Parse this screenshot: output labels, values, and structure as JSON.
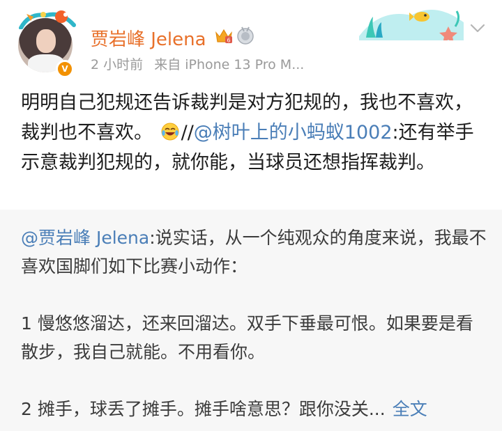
{
  "post": {
    "username": "贾岩峰 Jelena",
    "time": "2 小时前",
    "source": "来自 iPhone 13 Pro M...",
    "verified_badge": "V",
    "text_part1": "明明自己犯规还告诉裁判是对方犯规的，我也不喜欢，裁判也不喜欢。",
    "emoji": "laughing-crying-emoji",
    "text_sep": "//",
    "mention": "@树叶上的小蚂蚁1002",
    "text_part2": ":还有举手示意裁判犯规的，就你能，当球员还想指挥裁判。"
  },
  "retweet": {
    "mention": "@贾岩峰 Jelena",
    "para1": ":说实话，从一个纯观众的角度来说，我最不喜欢国脚们如下比赛小动作：",
    "para2": "1 慢悠悠溜达，还来回溜达。双手下垂最可恨。如果要是看散步，我自己就能。不用看你。",
    "para3": "2 摊手，球丢了摊手。摊手啥意思？跟你没关...",
    "full_text_link": "全文"
  },
  "colors": {
    "username": "#e8702a",
    "link": "#4a7eb7",
    "meta": "#9a9a9a",
    "retweet_bg": "#f7f7f7"
  }
}
